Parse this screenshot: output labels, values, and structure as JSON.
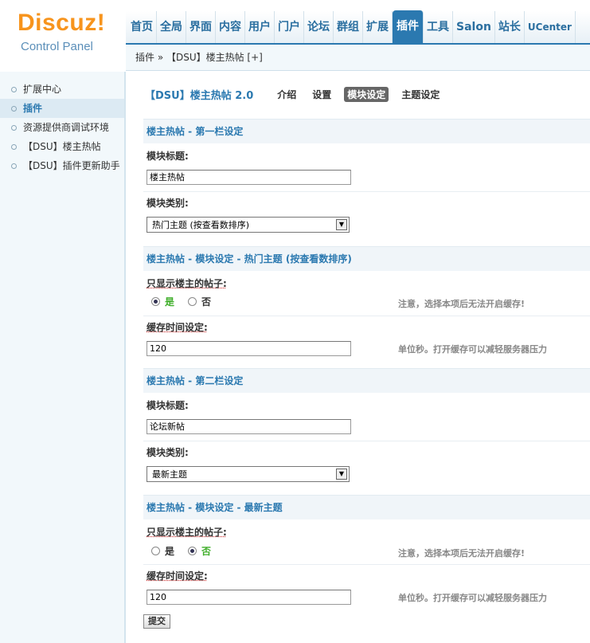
{
  "logo": {
    "title": "Discuz",
    "bang": "!",
    "subtitle": "Control Panel"
  },
  "topnav": [
    "首页",
    "全局",
    "界面",
    "内容",
    "用户",
    "门户",
    "论坛",
    "群组",
    "扩展",
    "插件",
    "工具",
    "Salon",
    "站长",
    "UCenter"
  ],
  "topnav_active": "插件",
  "breadcrumb": "插件 » 【DSU】楼主热帖 [+]",
  "sidebar": {
    "items": [
      {
        "label": "扩展中心"
      },
      {
        "label": "插件"
      },
      {
        "label": "资源提供商调试环境"
      },
      {
        "label": "【DSU】楼主热帖"
      },
      {
        "label": "【DSU】插件更新助手"
      }
    ]
  },
  "plugin": {
    "title": "【DSU】楼主热帖 2.0",
    "tabs": [
      "介绍",
      "设置",
      "模块设定",
      "主题设定"
    ]
  },
  "section1": {
    "header": "楼主热帖 - 第一栏设定",
    "title_label": "模块标题:",
    "title_value": "楼主热帖",
    "type_label": "模块类别:",
    "type_value": "热门主题 (按查看数排序)"
  },
  "section2": {
    "header": "楼主热帖 - 模块设定 - 热门主题 (按查看数排序)",
    "only_label": "只显示楼主的帖子:",
    "yes": "是",
    "no": "否",
    "only_tip": "注意，选择本项后无法开启缓存!",
    "cache_label": "缓存时间设定:",
    "cache_value": "120",
    "cache_tip": "单位秒。打开缓存可以减轻服务器压力"
  },
  "section3": {
    "header": "楼主热帖 - 第二栏设定",
    "title_label": "模块标题:",
    "title_value": "论坛新帖",
    "type_label": "模块类别:",
    "type_value": "最新主题"
  },
  "section4": {
    "header": "楼主热帖 - 模块设定 - 最新主题",
    "only_label": "只显示楼主的帖子:",
    "yes": "是",
    "no": "否",
    "only_tip": "注意，选择本项后无法开启缓存!",
    "cache_label": "缓存时间设定:",
    "cache_value": "120",
    "cache_tip": "单位秒。打开缓存可以减轻服务器压力"
  },
  "submit_label": "提交",
  "colors": {
    "brand": "#f7941d",
    "accent": "#2b79b0",
    "radio_on_label": "#3fae2a"
  }
}
